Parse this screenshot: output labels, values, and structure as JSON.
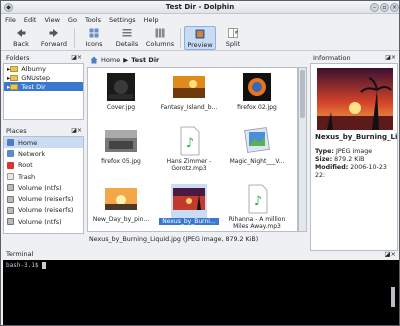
{
  "window": {
    "title": "Test Dir - Dolphin"
  },
  "menubar": [
    "File",
    "Edit",
    "View",
    "Go",
    "Tools",
    "Settings",
    "Help"
  ],
  "toolbar": {
    "back": "Back",
    "forward": "Forward",
    "icons": "Icons",
    "details": "Details",
    "columns": "Columns",
    "preview": "Preview",
    "split": "Split"
  },
  "folders": {
    "title": "Folders",
    "items": [
      "Albumy",
      "GNUstep",
      "Test Dir"
    ]
  },
  "places": {
    "title": "Places",
    "items": [
      "Home",
      "Network",
      "Root",
      "Trash",
      "Volume (ntfs)",
      "Volume (reiserfs)",
      "Volume (reiserfs)",
      "Volume (ntfs)"
    ]
  },
  "breadcrumb": {
    "home": "Home",
    "current": "Test Dir"
  },
  "files": [
    {
      "name": "Cover.jpg",
      "type": "img-dark"
    },
    {
      "name": "Fantasy_Island_b...",
      "type": "img-orange"
    },
    {
      "name": "firefox 02.jpg",
      "type": "img-firefox"
    },
    {
      "name": "firefox 05.jpg",
      "type": "img-gray"
    },
    {
      "name": "Hans Zimmer - Gorotz.mp3",
      "type": "audio"
    },
    {
      "name": "Magic_Night___V...",
      "type": "img-blue"
    },
    {
      "name": "New_Day_by_pin...",
      "type": "img-sunset"
    },
    {
      "name": "Nexus_by_Burni...",
      "type": "img-nexus"
    },
    {
      "name": "Rihanna - A million Miles Away.mp3",
      "type": "audio"
    }
  ],
  "status_text": "Nexus_by_Burning_Liquid.jpg (JPEG image, 879.2 KiB)",
  "info": {
    "title": "Information",
    "name": "Nexus_by_Burning_Liqu",
    "type_label": "Type:",
    "type": "JPEG image",
    "size_label": "Size:",
    "size": "879.2 KiB",
    "modified_label": "Modified:",
    "modified": "2006-10-23 22:"
  },
  "terminal": {
    "title": "Terminal",
    "prompt": "bash-3.1$ "
  },
  "colors": {
    "selection": "#3a78d0",
    "accent_light": "#c9dcf3"
  }
}
